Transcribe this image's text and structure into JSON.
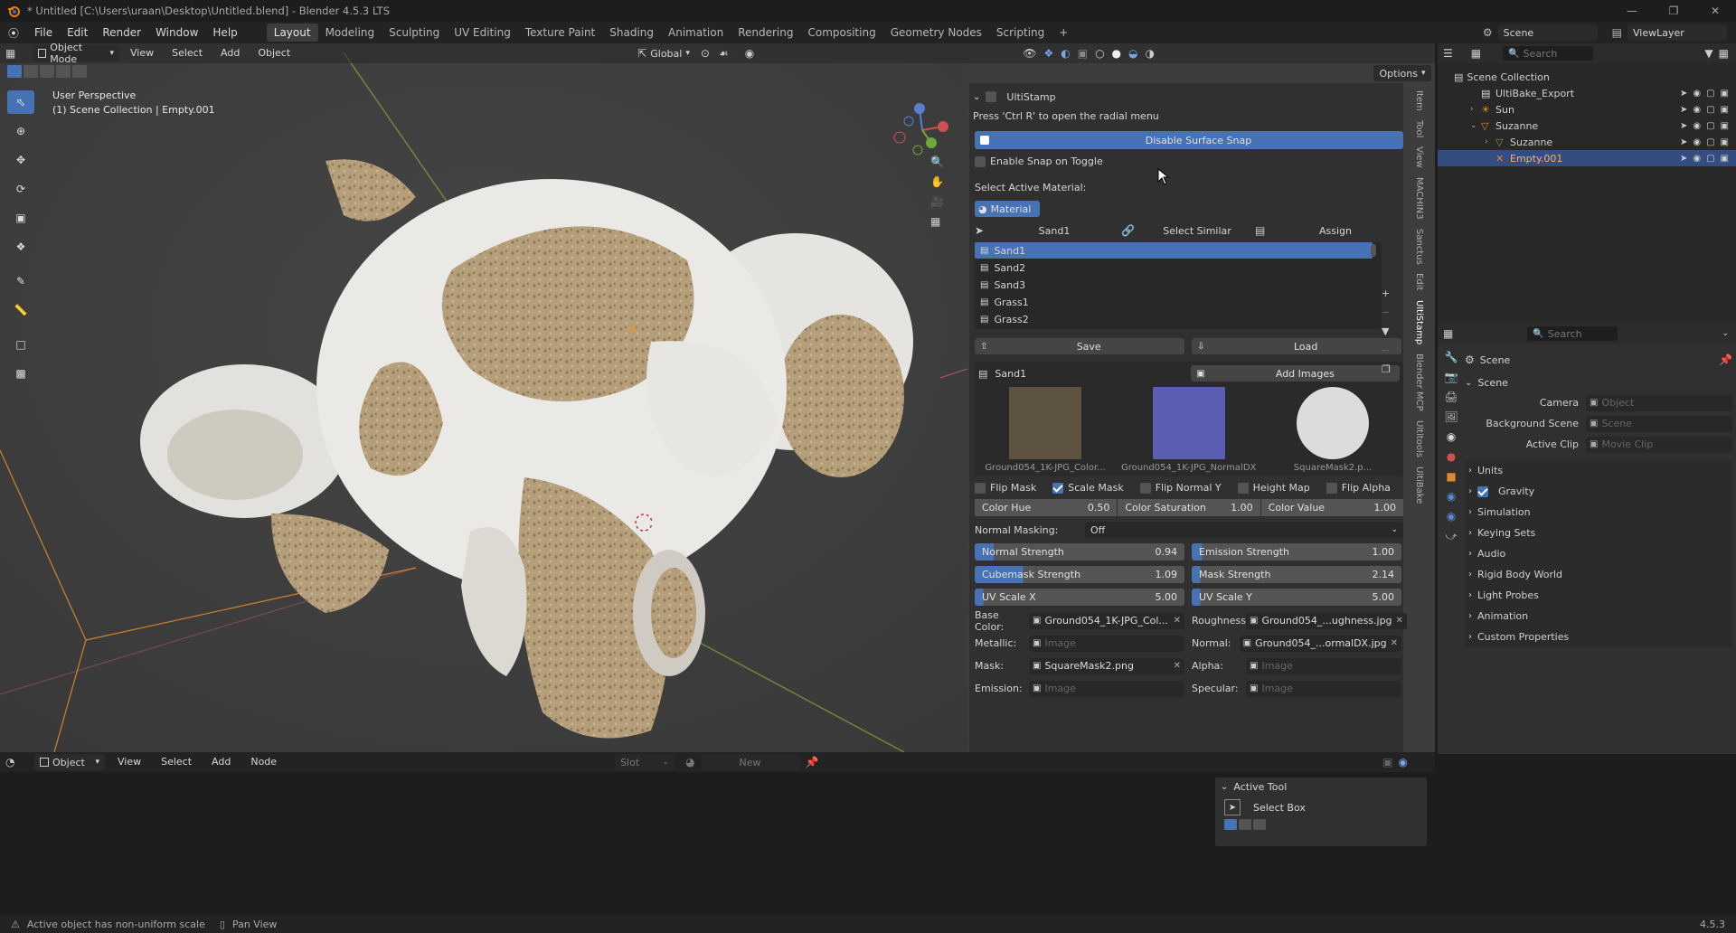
{
  "title_bar": {
    "window_title": "* Untitled [C:\\Users\\uraan\\Desktop\\Untitled.blend] - Blender 4.5.3 LTS"
  },
  "menu": {
    "items": [
      "File",
      "Edit",
      "Render",
      "Window",
      "Help"
    ],
    "workspaces": [
      "Layout",
      "Modeling",
      "Sculpting",
      "UV Editing",
      "Texture Paint",
      "Shading",
      "Animation",
      "Rendering",
      "Compositing",
      "Geometry Nodes",
      "Scripting"
    ],
    "active_workspace": "Layout",
    "scene": "Scene",
    "view_layer": "ViewLayer"
  },
  "viewport_header": {
    "mode": "Object Mode",
    "menus": [
      "View",
      "Select",
      "Add",
      "Object"
    ],
    "transform_orientation": "Global",
    "options_label": "Options"
  },
  "viewport": {
    "perspective_label": "User Perspective",
    "collection_label": "(1) Scene Collection | Empty.001"
  },
  "n_panel": {
    "tabs": [
      "Item",
      "Tool",
      "View",
      "MACHIN3",
      "Sanctus",
      "Edit",
      "UltiStamp",
      "Blender MCP",
      "Ultitools",
      "UltiBake"
    ],
    "active_tab": "UltiStamp",
    "panel_title": "UltiStamp",
    "hint": "Press 'Ctrl R' to open the radial menu",
    "disable_snap_label": "Disable Surface Snap",
    "enable_snap_label": "Enable Snap on Toggle",
    "select_material_label": "Select Active Material:",
    "material_button": "Material",
    "mat_bar": {
      "active": "Sand1",
      "select_similar": "Select Similar",
      "assign": "Assign"
    },
    "material_list": [
      "Sand1",
      "Sand2",
      "Sand3",
      "Grass1",
      "Grass2"
    ],
    "selected_index": 0,
    "save_label": "Save",
    "load_label": "Load",
    "material_name": "Sand1",
    "add_images_label": "Add Images",
    "thumbnails": [
      {
        "caption": "Ground054_1K-JPG_Color...",
        "color": "#5e5441"
      },
      {
        "caption": "Ground054_1K-JPG_NormalDX...",
        "color": "#5a5fb4"
      },
      {
        "caption": "SquareMask2.p...",
        "color": "#dcdcdc"
      }
    ],
    "toggles": [
      {
        "label": "Flip Mask",
        "checked": false
      },
      {
        "label": "Scale Mask",
        "checked": true
      },
      {
        "label": "Flip Normal Y",
        "checked": false
      },
      {
        "label": "Height Map",
        "checked": false
      },
      {
        "label": "Flip Alpha",
        "checked": false
      }
    ],
    "color_fields": [
      {
        "label": "Color Hue",
        "value": "0.50"
      },
      {
        "label": "Color Saturation",
        "value": "1.00"
      },
      {
        "label": "Color Value",
        "value": "1.00"
      }
    ],
    "normal_masking_label": "Normal Masking:",
    "normal_masking_value": "Off",
    "sliders": [
      {
        "label": "Normal Strength",
        "value": "0.94",
        "fill": 0.09
      },
      {
        "label": "Emission Strength",
        "value": "1.00",
        "fill": 0.05
      },
      {
        "label": "Cubemask Strength",
        "value": "1.09",
        "fill": 0.23
      },
      {
        "label": "Mask Strength",
        "value": "2.14",
        "fill": 0.0
      },
      {
        "label": "UV Scale X",
        "value": "5.00",
        "fill": 0.04
      },
      {
        "label": "UV Scale Y",
        "value": "5.00",
        "fill": 0.04
      }
    ],
    "image_slots": [
      {
        "label": "Base Color:",
        "value": "Ground054_1K-JPG_Col...",
        "empty": false
      },
      {
        "label": "Roughness:",
        "value": "Ground054_...ughness.jpg",
        "empty": false
      },
      {
        "label": "Metallic:",
        "value": "Image",
        "empty": true
      },
      {
        "label": "Normal:",
        "value": "Ground054_...ormalDX.jpg",
        "empty": false
      },
      {
        "label": "Mask:",
        "value": "SquareMask2.png",
        "empty": false
      },
      {
        "label": "Alpha:",
        "value": "Image",
        "empty": true
      },
      {
        "label": "Emission:",
        "value": "Image",
        "empty": true
      },
      {
        "label": "Specular:",
        "value": "Image",
        "empty": true
      }
    ]
  },
  "outliner": {
    "search_placeholder": "Search",
    "root": "Scene Collection",
    "items": [
      {
        "name": "UltiBake_Export",
        "depth": 1,
        "icon": "collection-icon",
        "selected": false
      },
      {
        "name": "Sun",
        "depth": 1,
        "icon": "light-icon",
        "selected": false
      },
      {
        "name": "Suzanne",
        "depth": 1,
        "icon": "mesh-object-icon",
        "selected": false
      },
      {
        "name": "Suzanne",
        "depth": 2,
        "icon": "mesh-data-icon",
        "selected": false
      },
      {
        "name": "Empty.001",
        "depth": 2,
        "icon": "empty-icon",
        "selected": true
      }
    ]
  },
  "properties": {
    "search_placeholder": "Search",
    "context": "Scene",
    "section": "Scene",
    "fields": [
      {
        "label": "Camera",
        "placeholder": "Object"
      },
      {
        "label": "Background Scene",
        "placeholder": "Scene"
      },
      {
        "label": "Active Clip",
        "placeholder": "Movie Clip"
      }
    ],
    "panels": [
      "Units",
      "Gravity",
      "Simulation",
      "Keying Sets",
      "Audio",
      "Rigid Body World",
      "Light Probes",
      "Animation",
      "Custom Properties"
    ],
    "gravity_checked": true
  },
  "shader_header": {
    "mode": "Object",
    "menus": [
      "View",
      "Select",
      "Add",
      "Node"
    ],
    "slot_label": "Slot",
    "new_label": "New"
  },
  "active_tool_panel": {
    "title": "Active Tool",
    "tool": "Select Box"
  },
  "status_bar": {
    "warning": "Active object has non-uniform scale",
    "pan_view": "Pan View",
    "version": "4.5.3"
  },
  "colors": {
    "accent": "#4772b3",
    "selection": "#334d80",
    "bg_dark": "#1d1d1d",
    "panel": "#303030",
    "orange_origin": "#ff8c1a"
  }
}
